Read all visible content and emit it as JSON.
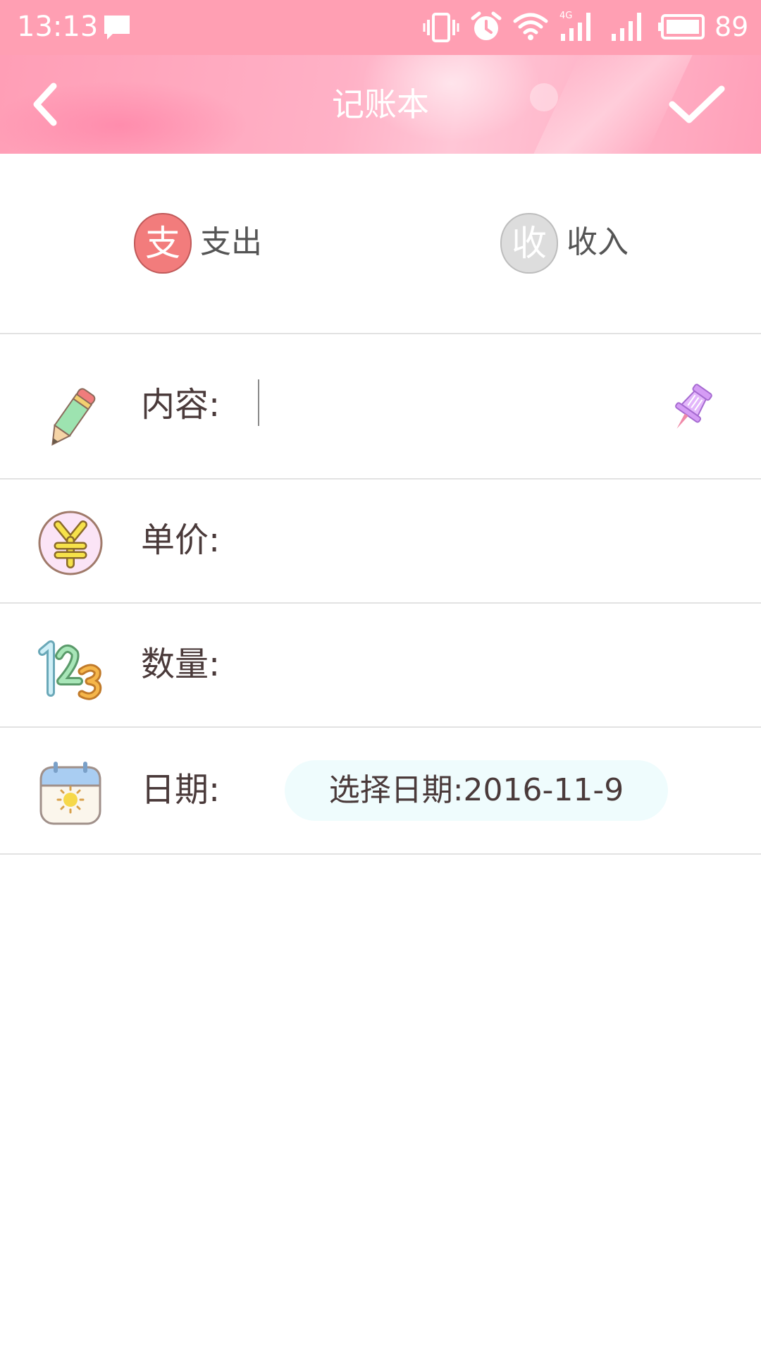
{
  "status_bar": {
    "time": "13:13",
    "battery": "89",
    "icons": [
      "message-icon",
      "vibrate-icon",
      "alarm-icon",
      "wifi-icon",
      "signal-4g-icon",
      "signal-icon",
      "battery-icon"
    ]
  },
  "title_bar": {
    "title": "记账本",
    "back_icon": "chevron-left-icon",
    "confirm_icon": "checkmark-icon"
  },
  "type_selector": {
    "expense": {
      "badge": "支",
      "label": "支出",
      "selected": true,
      "color": "#f27c7c"
    },
    "income": {
      "badge": "收",
      "label": "收入",
      "selected": false,
      "color": "#dddddd"
    }
  },
  "form": {
    "content": {
      "label": "内容:",
      "value": "",
      "icon": "pencil-icon",
      "action_icon": "pushpin-icon"
    },
    "price": {
      "label": "单价:",
      "value": "",
      "icon": "yuan-coin-icon"
    },
    "quantity": {
      "label": "数量:",
      "value": "",
      "icon": "numbers-123-icon"
    },
    "date": {
      "label": "日期:",
      "button_text": "选择日期:2016-11-9",
      "icon": "calendar-icon"
    }
  },
  "colors": {
    "primary": "#ff9fb3",
    "expense": "#f27c7c",
    "date_button_bg": "#effcfd",
    "label_text": "#4a3a3a"
  }
}
